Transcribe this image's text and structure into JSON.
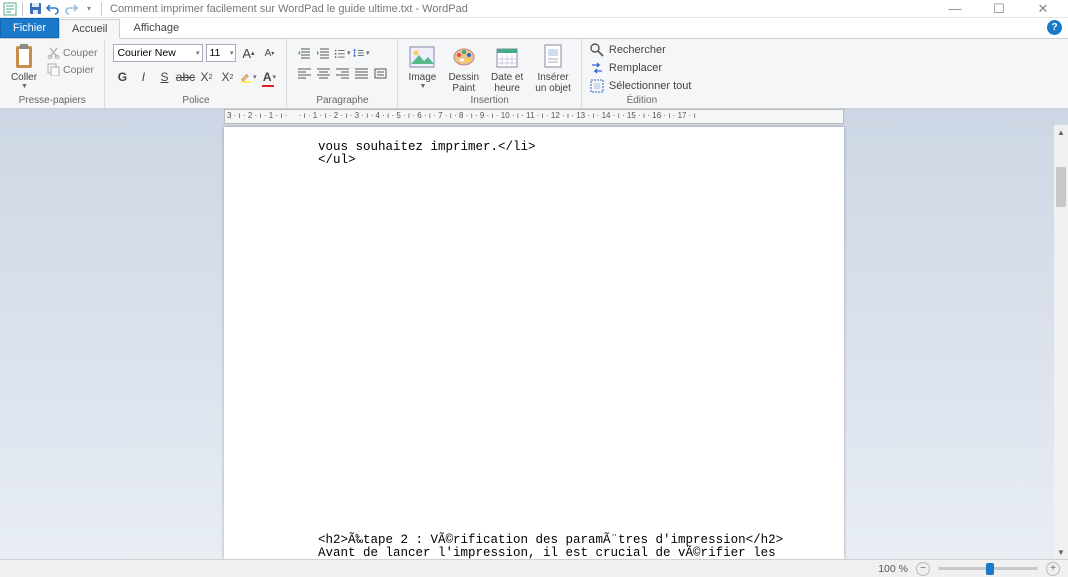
{
  "title": "Comment imprimer facilement sur WordPad  le guide ultime.txt - WordPad",
  "tabs": {
    "file": "Fichier",
    "home": "Accueil",
    "view": "Affichage"
  },
  "clipboard": {
    "paste": "Coller",
    "cut": "Couper",
    "copy": "Copier",
    "label": "Presse-papiers"
  },
  "font": {
    "name": "Courier New",
    "size": "11",
    "label": "Police",
    "grow": "A",
    "shrink": "A"
  },
  "paragraph": {
    "label": "Paragraphe"
  },
  "insert": {
    "label": "Insertion",
    "image": "Image",
    "paint": "Dessin\nPaint",
    "datetime": "Date et\nheure",
    "object": "Insérer\nun objet"
  },
  "editing": {
    "label": "Édition",
    "find": "Rechercher",
    "replace": "Remplacer",
    "selectall": "Sélectionner tout"
  },
  "document": {
    "line1": "vous souhaitez imprimer.</li>",
    "line2": "</ul>",
    "line3": "<h2>Ã‰tape 2 : VÃ©rification des paramÃ¨tres d'impression</h2>",
    "line4": "Avant de lancer l'impression, il est crucial de vÃ©rifier les"
  },
  "statusbar": {
    "zoom": "100 %"
  },
  "ruler_ticks": [
    "3",
    "2",
    "1",
    "1",
    "2",
    "3",
    "4",
    "5",
    "6",
    "7",
    "8",
    "9",
    "10",
    "11",
    "12",
    "13",
    "14",
    "15",
    "16",
    "17"
  ]
}
